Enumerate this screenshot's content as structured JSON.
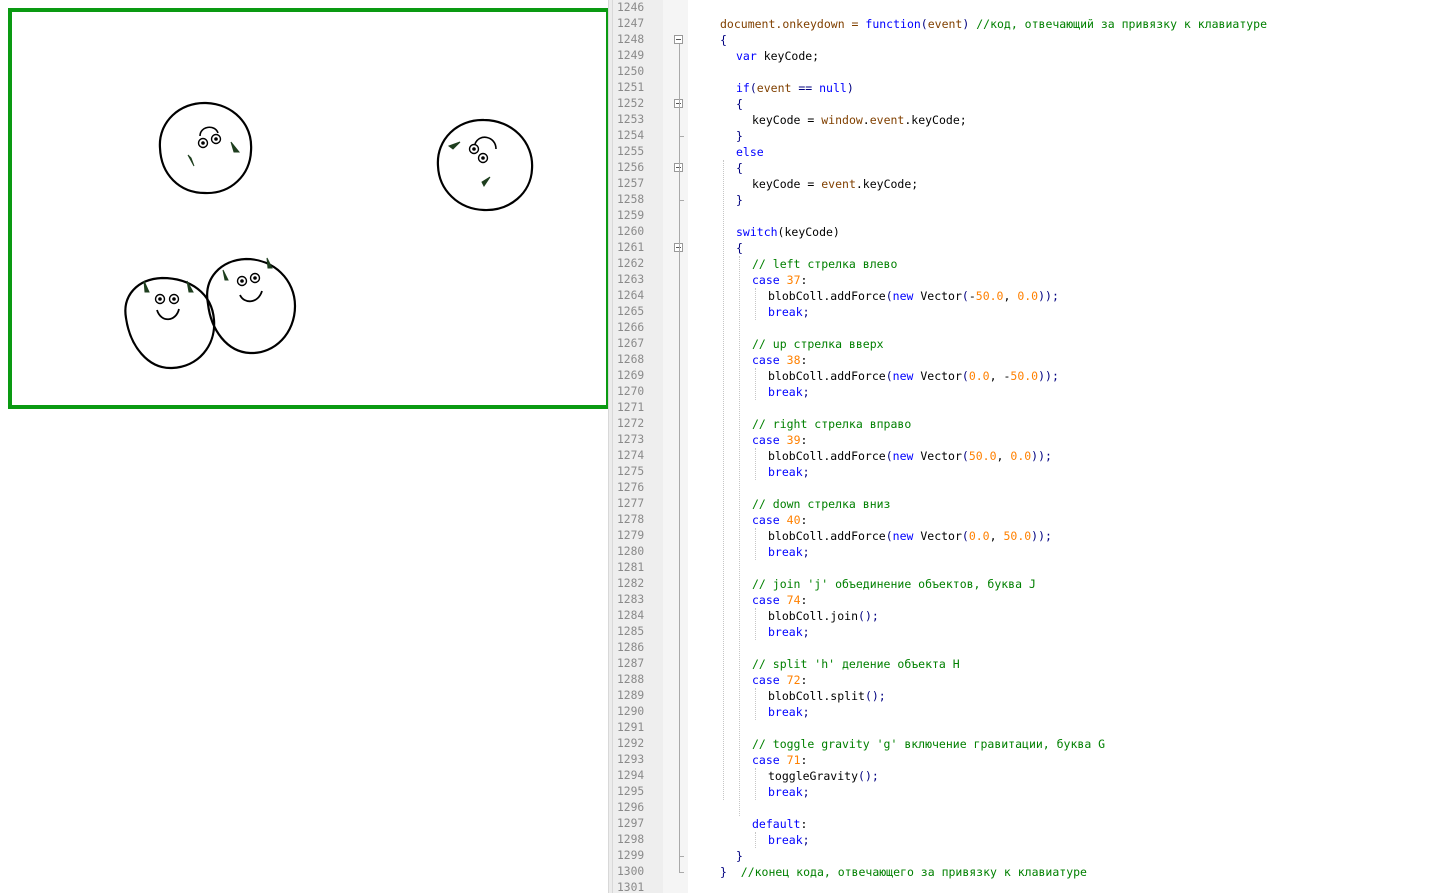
{
  "canvas": {
    "border_color": "#0a9a12",
    "blob_count": 4
  },
  "editor": {
    "colors": {
      "keyword": "#0000ff",
      "comment": "#008000",
      "number": "#ff8000",
      "variable": "#804000"
    },
    "lines": [
      {
        "n": "1246",
        "indent": 0,
        "tokens": []
      },
      {
        "n": "1247",
        "indent": 0,
        "tokens": [
          {
            "t": "document",
            "c": "v"
          },
          {
            "t": ".onkeydown = ",
            "c": "v"
          },
          {
            "t": "function",
            "c": "k"
          },
          {
            "t": "(",
            "c": "p"
          },
          {
            "t": "event",
            "c": "v"
          },
          {
            "t": ") ",
            "c": "p"
          },
          {
            "t": "//код, отвечающий за привязку к клавиатуре",
            "c": "c"
          }
        ]
      },
      {
        "n": "1248",
        "indent": 0,
        "tokens": [
          {
            "t": "{",
            "c": "p"
          }
        ]
      },
      {
        "n": "1249",
        "indent": 2,
        "tokens": [
          {
            "t": "var",
            "c": "k"
          },
          {
            "t": " keyCode;",
            "c": ""
          }
        ]
      },
      {
        "n": "1250",
        "indent": 0,
        "tokens": []
      },
      {
        "n": "1251",
        "indent": 2,
        "tokens": [
          {
            "t": "if",
            "c": "k"
          },
          {
            "t": "(",
            "c": "p"
          },
          {
            "t": "event",
            "c": "v"
          },
          {
            "t": " == ",
            "c": "p"
          },
          {
            "t": "null",
            "c": "k"
          },
          {
            "t": ")",
            "c": "p"
          }
        ]
      },
      {
        "n": "1252",
        "indent": 2,
        "tokens": [
          {
            "t": "{",
            "c": "p"
          }
        ]
      },
      {
        "n": "1253",
        "indent": 4,
        "tokens": [
          {
            "t": "keyCode = ",
            "c": ""
          },
          {
            "t": "window",
            "c": "v"
          },
          {
            "t": ".",
            "c": ""
          },
          {
            "t": "event",
            "c": "v"
          },
          {
            "t": ".keyCode;",
            "c": ""
          }
        ]
      },
      {
        "n": "1254",
        "indent": 2,
        "tokens": [
          {
            "t": "}",
            "c": "p"
          }
        ]
      },
      {
        "n": "1255",
        "indent": 2,
        "tokens": [
          {
            "t": "else",
            "c": "k"
          }
        ]
      },
      {
        "n": "1256",
        "indent": 2,
        "tokens": [
          {
            "t": "{",
            "c": "p"
          }
        ]
      },
      {
        "n": "1257",
        "indent": 4,
        "tokens": [
          {
            "t": "keyCode = ",
            "c": ""
          },
          {
            "t": "event",
            "c": "v"
          },
          {
            "t": ".keyCode;",
            "c": ""
          }
        ]
      },
      {
        "n": "1258",
        "indent": 2,
        "tokens": [
          {
            "t": "}",
            "c": "p"
          }
        ]
      },
      {
        "n": "1259",
        "indent": 0,
        "tokens": []
      },
      {
        "n": "1260",
        "indent": 2,
        "tokens": [
          {
            "t": "switch",
            "c": "k"
          },
          {
            "t": "(keyCode)",
            "c": ""
          }
        ]
      },
      {
        "n": "1261",
        "indent": 2,
        "tokens": [
          {
            "t": "{",
            "c": "p"
          }
        ]
      },
      {
        "n": "1262",
        "indent": 4,
        "tokens": [
          {
            "t": "// left стрелка влево",
            "c": "c"
          }
        ]
      },
      {
        "n": "1263",
        "indent": 4,
        "tokens": [
          {
            "t": "case",
            "c": "k"
          },
          {
            "t": " ",
            "c": ""
          },
          {
            "t": "37",
            "c": "n"
          },
          {
            "t": ":",
            "c": ""
          }
        ]
      },
      {
        "n": "1264",
        "indent": 6,
        "tokens": [
          {
            "t": "blobColl.addForce",
            "c": ""
          },
          {
            "t": "(",
            "c": "p"
          },
          {
            "t": "new",
            "c": "k"
          },
          {
            "t": " Vector",
            "c": ""
          },
          {
            "t": "(",
            "c": "p"
          },
          {
            "t": "-",
            "c": ""
          },
          {
            "t": "50.0",
            "c": "n"
          },
          {
            "t": ", ",
            "c": ""
          },
          {
            "t": "0.0",
            "c": "n"
          },
          {
            "t": "));",
            "c": "p"
          }
        ]
      },
      {
        "n": "1265",
        "indent": 6,
        "tokens": [
          {
            "t": "break",
            "c": "k"
          },
          {
            "t": ";",
            "c": "p"
          }
        ]
      },
      {
        "n": "1266",
        "indent": 0,
        "tokens": []
      },
      {
        "n": "1267",
        "indent": 4,
        "tokens": [
          {
            "t": "// up стрелка вверх",
            "c": "c"
          }
        ]
      },
      {
        "n": "1268",
        "indent": 4,
        "tokens": [
          {
            "t": "case",
            "c": "k"
          },
          {
            "t": " ",
            "c": ""
          },
          {
            "t": "38",
            "c": "n"
          },
          {
            "t": ":",
            "c": ""
          }
        ]
      },
      {
        "n": "1269",
        "indent": 6,
        "tokens": [
          {
            "t": "blobColl.addForce",
            "c": ""
          },
          {
            "t": "(",
            "c": "p"
          },
          {
            "t": "new",
            "c": "k"
          },
          {
            "t": " Vector",
            "c": ""
          },
          {
            "t": "(",
            "c": "p"
          },
          {
            "t": "0.0",
            "c": "n"
          },
          {
            "t": ", -",
            "c": ""
          },
          {
            "t": "50.0",
            "c": "n"
          },
          {
            "t": "));",
            "c": "p"
          }
        ]
      },
      {
        "n": "1270",
        "indent": 6,
        "tokens": [
          {
            "t": "break",
            "c": "k"
          },
          {
            "t": ";",
            "c": "p"
          }
        ]
      },
      {
        "n": "1271",
        "indent": 0,
        "tokens": []
      },
      {
        "n": "1272",
        "indent": 4,
        "tokens": [
          {
            "t": "// right стрелка вправо",
            "c": "c"
          }
        ]
      },
      {
        "n": "1273",
        "indent": 4,
        "tokens": [
          {
            "t": "case",
            "c": "k"
          },
          {
            "t": " ",
            "c": ""
          },
          {
            "t": "39",
            "c": "n"
          },
          {
            "t": ":",
            "c": ""
          }
        ]
      },
      {
        "n": "1274",
        "indent": 6,
        "tokens": [
          {
            "t": "blobColl.addForce",
            "c": ""
          },
          {
            "t": "(",
            "c": "p"
          },
          {
            "t": "new",
            "c": "k"
          },
          {
            "t": " Vector",
            "c": ""
          },
          {
            "t": "(",
            "c": "p"
          },
          {
            "t": "50.0",
            "c": "n"
          },
          {
            "t": ", ",
            "c": ""
          },
          {
            "t": "0.0",
            "c": "n"
          },
          {
            "t": "));",
            "c": "p"
          }
        ]
      },
      {
        "n": "1275",
        "indent": 6,
        "tokens": [
          {
            "t": "break",
            "c": "k"
          },
          {
            "t": ";",
            "c": "p"
          }
        ]
      },
      {
        "n": "1276",
        "indent": 0,
        "tokens": []
      },
      {
        "n": "1277",
        "indent": 4,
        "tokens": [
          {
            "t": "// down стрелка вниз",
            "c": "c"
          }
        ]
      },
      {
        "n": "1278",
        "indent": 4,
        "tokens": [
          {
            "t": "case",
            "c": "k"
          },
          {
            "t": " ",
            "c": ""
          },
          {
            "t": "40",
            "c": "n"
          },
          {
            "t": ":",
            "c": ""
          }
        ]
      },
      {
        "n": "1279",
        "indent": 6,
        "tokens": [
          {
            "t": "blobColl.addForce",
            "c": ""
          },
          {
            "t": "(",
            "c": "p"
          },
          {
            "t": "new",
            "c": "k"
          },
          {
            "t": " Vector",
            "c": ""
          },
          {
            "t": "(",
            "c": "p"
          },
          {
            "t": "0.0",
            "c": "n"
          },
          {
            "t": ", ",
            "c": ""
          },
          {
            "t": "50.0",
            "c": "n"
          },
          {
            "t": "));",
            "c": "p"
          }
        ]
      },
      {
        "n": "1280",
        "indent": 6,
        "tokens": [
          {
            "t": "break",
            "c": "k"
          },
          {
            "t": ";",
            "c": "p"
          }
        ]
      },
      {
        "n": "1281",
        "indent": 0,
        "tokens": []
      },
      {
        "n": "1282",
        "indent": 4,
        "tokens": [
          {
            "t": "// join 'j' объединение объектов, буква J",
            "c": "c"
          }
        ]
      },
      {
        "n": "1283",
        "indent": 4,
        "tokens": [
          {
            "t": "case",
            "c": "k"
          },
          {
            "t": " ",
            "c": ""
          },
          {
            "t": "74",
            "c": "n"
          },
          {
            "t": ":",
            "c": ""
          }
        ]
      },
      {
        "n": "1284",
        "indent": 6,
        "tokens": [
          {
            "t": "blobColl.join",
            "c": ""
          },
          {
            "t": "();",
            "c": "p"
          }
        ]
      },
      {
        "n": "1285",
        "indent": 6,
        "tokens": [
          {
            "t": "break",
            "c": "k"
          },
          {
            "t": ";",
            "c": "p"
          }
        ]
      },
      {
        "n": "1286",
        "indent": 0,
        "tokens": []
      },
      {
        "n": "1287",
        "indent": 4,
        "tokens": [
          {
            "t": "// split 'h' деление объекта H",
            "c": "c"
          }
        ]
      },
      {
        "n": "1288",
        "indent": 4,
        "tokens": [
          {
            "t": "case",
            "c": "k"
          },
          {
            "t": " ",
            "c": ""
          },
          {
            "t": "72",
            "c": "n"
          },
          {
            "t": ":",
            "c": ""
          }
        ]
      },
      {
        "n": "1289",
        "indent": 6,
        "tokens": [
          {
            "t": "blobColl.split",
            "c": ""
          },
          {
            "t": "();",
            "c": "p"
          }
        ]
      },
      {
        "n": "1290",
        "indent": 6,
        "tokens": [
          {
            "t": "break",
            "c": "k"
          },
          {
            "t": ";",
            "c": "p"
          }
        ]
      },
      {
        "n": "1291",
        "indent": 0,
        "tokens": []
      },
      {
        "n": "1292",
        "indent": 4,
        "tokens": [
          {
            "t": "// toggle gravity 'g' включение гравитации, буква G",
            "c": "c"
          }
        ]
      },
      {
        "n": "1293",
        "indent": 4,
        "tokens": [
          {
            "t": "case",
            "c": "k"
          },
          {
            "t": " ",
            "c": ""
          },
          {
            "t": "71",
            "c": "n"
          },
          {
            "t": ":",
            "c": ""
          }
        ]
      },
      {
        "n": "1294",
        "indent": 6,
        "tokens": [
          {
            "t": "toggleGravity",
            "c": ""
          },
          {
            "t": "();",
            "c": "p"
          }
        ]
      },
      {
        "n": "1295",
        "indent": 6,
        "tokens": [
          {
            "t": "break",
            "c": "k"
          },
          {
            "t": ";",
            "c": "p"
          }
        ]
      },
      {
        "n": "1296",
        "indent": 0,
        "tokens": []
      },
      {
        "n": "1297",
        "indent": 4,
        "tokens": [
          {
            "t": "default",
            "c": "k"
          },
          {
            "t": ":",
            "c": ""
          }
        ]
      },
      {
        "n": "1298",
        "indent": 6,
        "tokens": [
          {
            "t": "break",
            "c": "k"
          },
          {
            "t": ";",
            "c": "p"
          }
        ]
      },
      {
        "n": "1299",
        "indent": 2,
        "tokens": [
          {
            "t": "}",
            "c": "p"
          }
        ]
      },
      {
        "n": "1300",
        "indent": 0,
        "tokens": [
          {
            "t": "}",
            "c": "p"
          },
          {
            "t": "  //конец кода, отвечающего за привязку к клавиатуре",
            "c": "c"
          }
        ]
      },
      {
        "n": "1301",
        "indent": 0,
        "tokens": []
      }
    ]
  }
}
